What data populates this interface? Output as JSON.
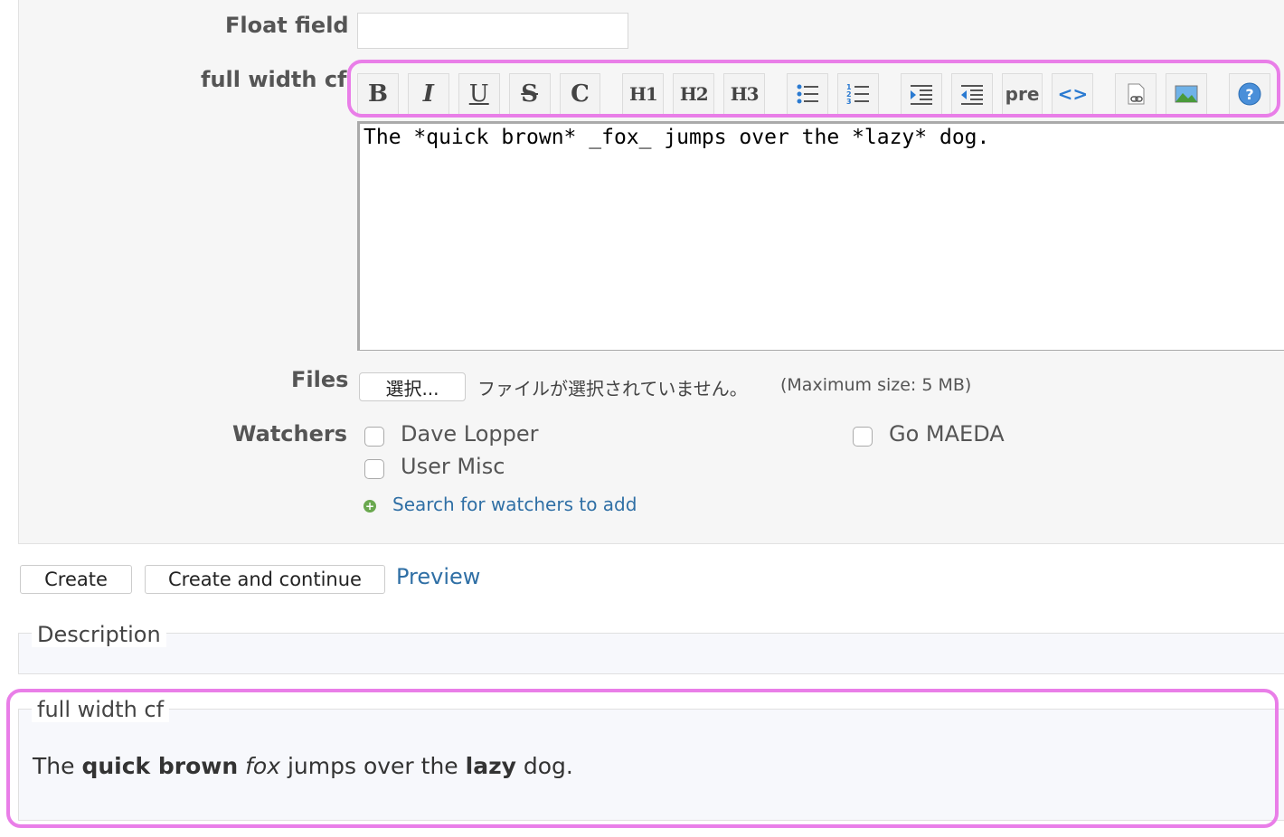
{
  "form": {
    "float_field_label": "Float field",
    "full_width_label": "full width cf",
    "files_label": "Files",
    "watchers_label": "Watchers"
  },
  "toolbar": {
    "buttons": [
      {
        "name": "bold",
        "label": "B"
      },
      {
        "name": "italic",
        "label": "I"
      },
      {
        "name": "underline",
        "label": "U"
      },
      {
        "name": "strikethrough",
        "label": "S"
      },
      {
        "name": "code-inline",
        "label": "C"
      },
      {
        "name": "heading-1",
        "label": "H1"
      },
      {
        "name": "heading-2",
        "label": "H2"
      },
      {
        "name": "heading-3",
        "label": "H3"
      },
      {
        "name": "unordered-list",
        "icon": "bullet-list-icon"
      },
      {
        "name": "ordered-list",
        "icon": "numbered-list-icon"
      },
      {
        "name": "indent",
        "icon": "indent-icon"
      },
      {
        "name": "outdent",
        "icon": "outdent-icon"
      },
      {
        "name": "preformatted",
        "label": "pre"
      },
      {
        "name": "code-highlight",
        "label": "<>"
      },
      {
        "name": "link",
        "icon": "link-icon"
      },
      {
        "name": "image",
        "icon": "image-icon"
      },
      {
        "name": "help",
        "icon": "help-icon"
      }
    ]
  },
  "editor": {
    "value": "The *quick brown* _fox_ jumps over the *lazy* dog."
  },
  "files": {
    "choose_label": "選択...",
    "no_file_text": "ファイルが選択されていません。",
    "max_size_text": "(Maximum size: 5 MB)"
  },
  "watchers": {
    "people": [
      "Dave Lopper",
      "Go MAEDA",
      "User Misc"
    ],
    "search_link": "Search for watchers to add"
  },
  "actions": {
    "create": "Create",
    "create_continue": "Create and continue",
    "preview": "Preview"
  },
  "preview_section": {
    "description_legend": "Description",
    "fullwidth_legend": "full width cf",
    "text_parts": {
      "p1": "The ",
      "b1": "quick brown",
      "p2": " ",
      "i1": "fox",
      "p3": " jumps over the ",
      "b2": "lazy",
      "p4": " dog."
    }
  },
  "colors": {
    "highlight": "#e97ee8",
    "link": "#2f6fa5",
    "panel_bg": "#f6f6f6"
  }
}
